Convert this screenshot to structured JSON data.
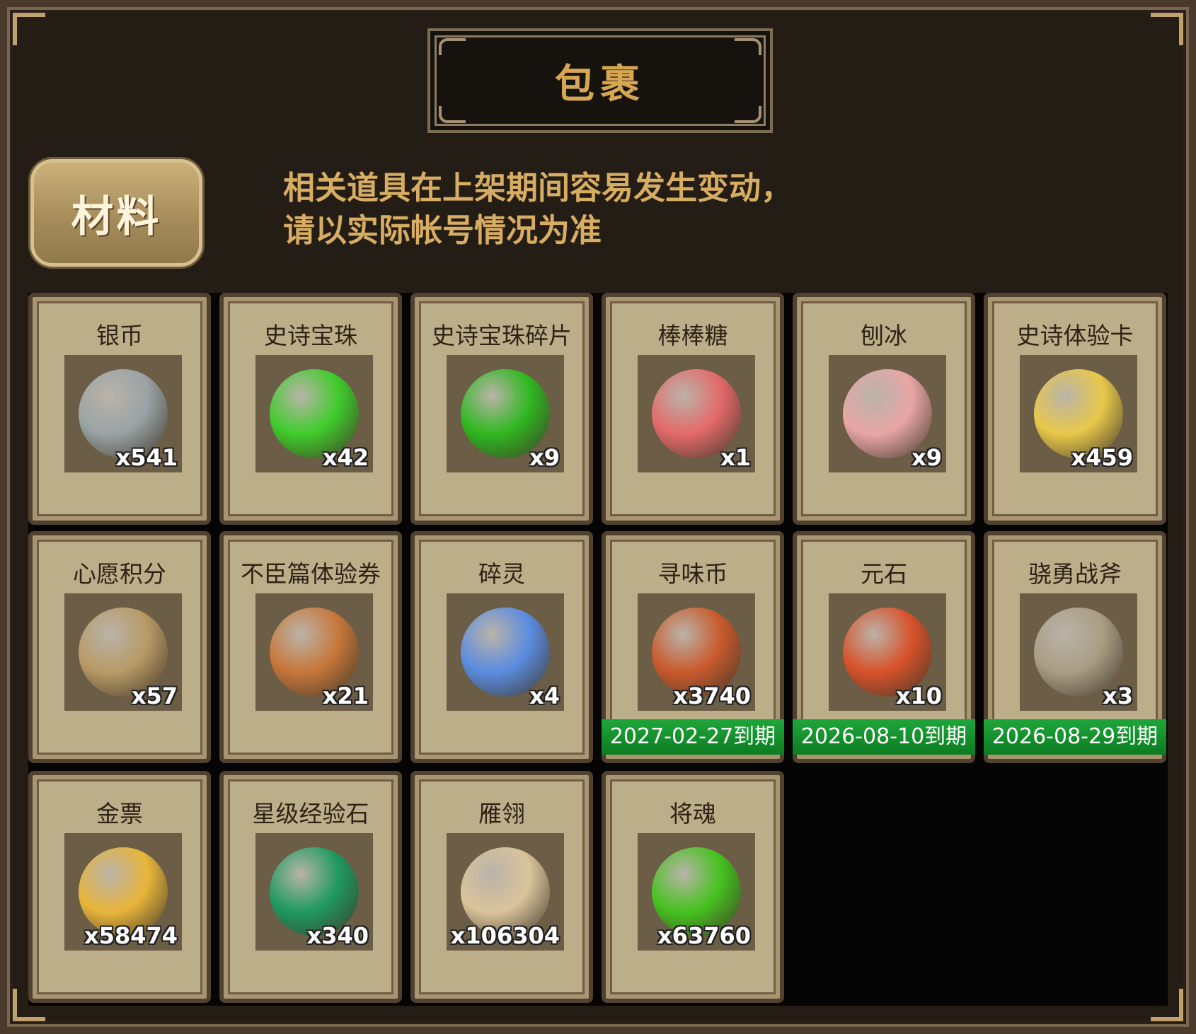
{
  "title": "包裹",
  "tab_label": "材料",
  "notice": {
    "line1": "相关道具在上架期间容易发生变动，",
    "line2": "请以实际帐号情况为准"
  },
  "items": [
    {
      "name": "银币",
      "qty": "x541",
      "icon": "silver-coin-icon",
      "color": "#9aa3a5"
    },
    {
      "name": "史诗宝珠",
      "qty": "x42",
      "icon": "green-orb-icon",
      "color": "#3fcc2b"
    },
    {
      "name": "史诗宝珠碎片",
      "qty": "x9",
      "icon": "green-shard-icon",
      "color": "#2fb820"
    },
    {
      "name": "棒棒糖",
      "qty": "x1",
      "icon": "lollipop-icon",
      "color": "#e46a6a"
    },
    {
      "name": "刨冰",
      "qty": "x9",
      "icon": "shaved-ice-icon",
      "color": "#e8a6a6"
    },
    {
      "name": "史诗体验卡",
      "qty": "x459",
      "icon": "gold-card-icon",
      "color": "#e8c84a"
    },
    {
      "name": "心愿积分",
      "qty": "x57",
      "icon": "heart-coin-icon",
      "color": "#b89a66"
    },
    {
      "name": "不臣篇体验券",
      "qty": "x21",
      "icon": "ticket-icon",
      "color": "#c7773a"
    },
    {
      "name": "碎灵",
      "qty": "x4",
      "icon": "blue-crystal-icon",
      "color": "#5a8ce0"
    },
    {
      "name": "寻味币",
      "qty": "x3740",
      "icon": "taste-coin-icon",
      "color": "#c95a2c",
      "expiry": "2027-02-27到期"
    },
    {
      "name": "元石",
      "qty": "x10",
      "icon": "fire-stone-icon",
      "color": "#d8522a",
      "expiry": "2026-08-10到期"
    },
    {
      "name": "骁勇战斧",
      "qty": "x3",
      "icon": "battle-axe-icon",
      "color": "#a99d83",
      "expiry": "2026-08-29到期"
    },
    {
      "name": "金票",
      "qty": "x58474",
      "icon": "gold-scroll-icon",
      "color": "#e8b53a"
    },
    {
      "name": "星级经验石",
      "qty": "x340",
      "icon": "jade-stone-icon",
      "color": "#1e9a60"
    },
    {
      "name": "雁翎",
      "qty": "x106304",
      "icon": "feather-icon",
      "color": "#d9c39a"
    },
    {
      "name": "将魂",
      "qty": "x63760",
      "icon": "soul-crystal-icon",
      "color": "#45c21e"
    }
  ]
}
